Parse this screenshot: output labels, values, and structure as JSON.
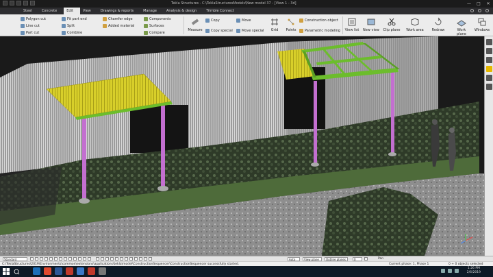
{
  "window": {
    "title": "Tekla Structures - C:\\TeklaStructuresModels\\New model 37 - [View 1 - 3d]",
    "controls": [
      "—",
      "□",
      "✕"
    ]
  },
  "menu": {
    "items": [
      "Steel",
      "Concrete",
      "Edit",
      "View",
      "Drawings & reports",
      "Manage",
      "Analysis & design",
      "Trimble Connect"
    ],
    "active": "Edit"
  },
  "ribbon": {
    "col1": [
      "Polygon cut",
      "Line cut",
      "Part cut"
    ],
    "col2": [
      "Fit part end",
      "Split",
      "Combine"
    ],
    "col3": [
      "Chamfer edge",
      "Added material"
    ],
    "col4": [
      "Components",
      "Surfaces",
      "Compare"
    ],
    "measure": "Measure",
    "col5": [
      "Copy",
      "Copy special"
    ],
    "col6": [
      "Move",
      "Move special"
    ],
    "grid": "Grid",
    "points": "Points",
    "col7": [
      "Construction object",
      "Parametric modeling"
    ],
    "big": [
      "View list",
      "New view",
      "Clip plane",
      "Work area",
      "Redraw",
      "Work plane",
      "Windows"
    ]
  },
  "bottombar": {
    "select_left": "Standard",
    "snap_mode": "Auto",
    "plane_mode": "View plane",
    "outline": "Outline planes",
    "offset_value": "0",
    "pan_label": "Pan"
  },
  "statusbar": {
    "message": "C:\\TeklaStructures\\2019\\Environments\\common\\extensions\\applications\\tekla\\model\\ConstructionSequencer\\ConstructionSequencer successfully started.",
    "phase": "Current phase: 1, Phase 1",
    "selection": "0 + 0 objects selected"
  },
  "taskbar": {
    "time": "1:26 PM",
    "date": "2/6/2019"
  },
  "colors": {
    "roof": "#d8cf2a",
    "beam": "#6cbd2c",
    "column": "#c36fd0",
    "viewport_bg": "#1a1a1a",
    "grass": "#4e6b3a"
  }
}
